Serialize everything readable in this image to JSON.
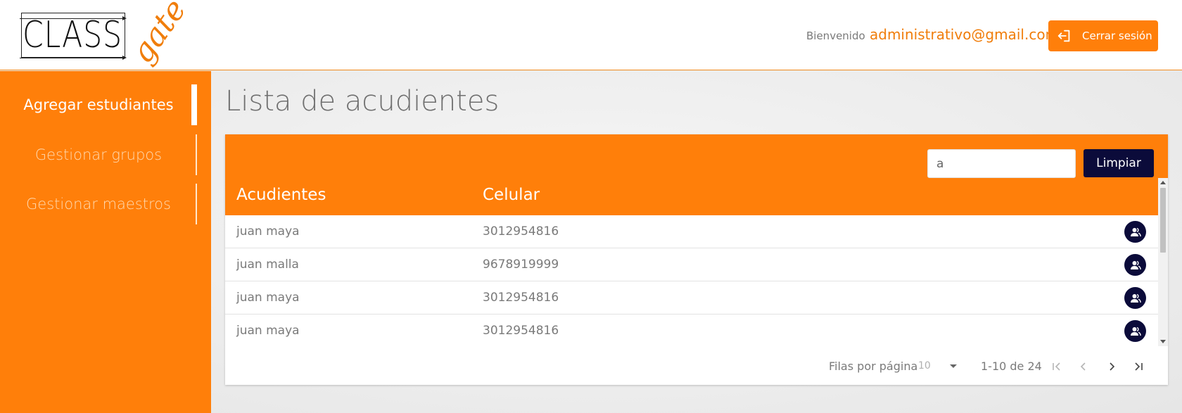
{
  "app": {
    "logo_text": "CLASS",
    "logo_accent": "gate",
    "brand_color": "#ff7f0a",
    "dark_color": "#0b0b3a"
  },
  "header": {
    "welcome": "Bienvenido",
    "email": "administrativo@gmail.com",
    "logout_label": "Cerrar sesión",
    "logout_icon": "logout-icon"
  },
  "sidebar": {
    "items": [
      {
        "label": "Agregar estudiantes",
        "active": true
      },
      {
        "label": "Gestionar grupos",
        "active": false
      },
      {
        "label": "Gestionar maestros",
        "active": false
      }
    ]
  },
  "main": {
    "title": "Lista de acudientes",
    "search": {
      "value": "a",
      "placeholder": ""
    },
    "clear_label": "Limpiar",
    "columns": [
      "Acudientes",
      "Celular"
    ],
    "rows": [
      {
        "name": "juan maya",
        "phone": "3012954816",
        "action_icon": "user-group-icon"
      },
      {
        "name": "juan malla",
        "phone": "9678919999",
        "action_icon": "user-group-icon"
      },
      {
        "name": "juan maya",
        "phone": "3012954816",
        "action_icon": "user-group-icon"
      },
      {
        "name": "juan maya",
        "phone": "3012954816",
        "action_icon": "user-group-icon"
      }
    ],
    "pagination": {
      "rows_per_page_label": "Filas por página",
      "rows_per_page": "10",
      "range": "1-10 de 24",
      "first_icon": "first-page-icon",
      "prev_icon": "chevron-left-icon",
      "next_icon": "chevron-right-icon",
      "last_icon": "last-page-icon"
    }
  }
}
